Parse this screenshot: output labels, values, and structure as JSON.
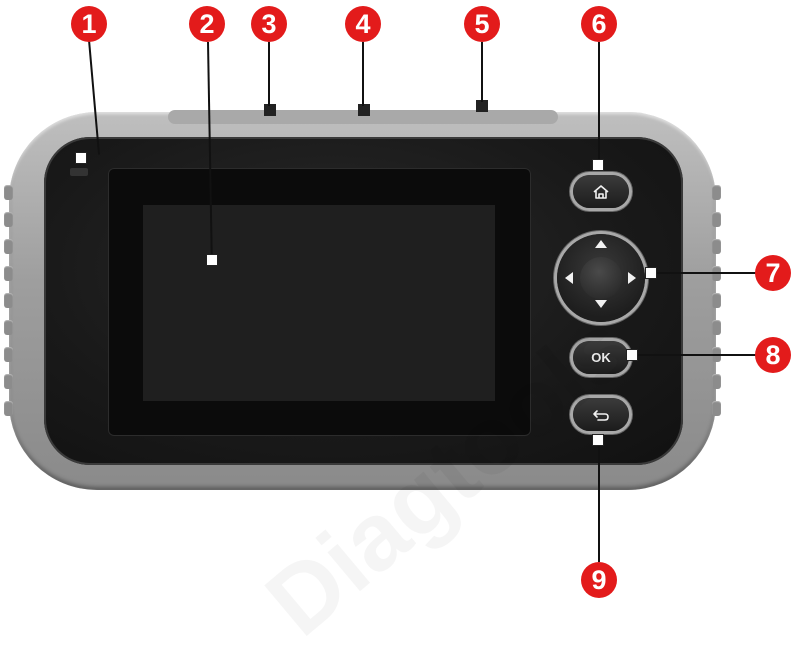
{
  "figure": {
    "callouts": [
      {
        "id": "callout-1",
        "label": "1"
      },
      {
        "id": "callout-2",
        "label": "2"
      },
      {
        "id": "callout-3",
        "label": "3"
      },
      {
        "id": "callout-4",
        "label": "4"
      },
      {
        "id": "callout-5",
        "label": "5"
      },
      {
        "id": "callout-6",
        "label": "6"
      },
      {
        "id": "callout-7",
        "label": "7"
      },
      {
        "id": "callout-8",
        "label": "8"
      },
      {
        "id": "callout-9",
        "label": "9"
      }
    ],
    "buttons": {
      "home_icon": "home-icon",
      "ok_label": "OK",
      "back_icon": "back-arrow-icon"
    },
    "colors": {
      "callout": "#e31b1b",
      "shell": "#9e9e9e",
      "face": "#191919"
    },
    "watermark": "Diagtools"
  }
}
